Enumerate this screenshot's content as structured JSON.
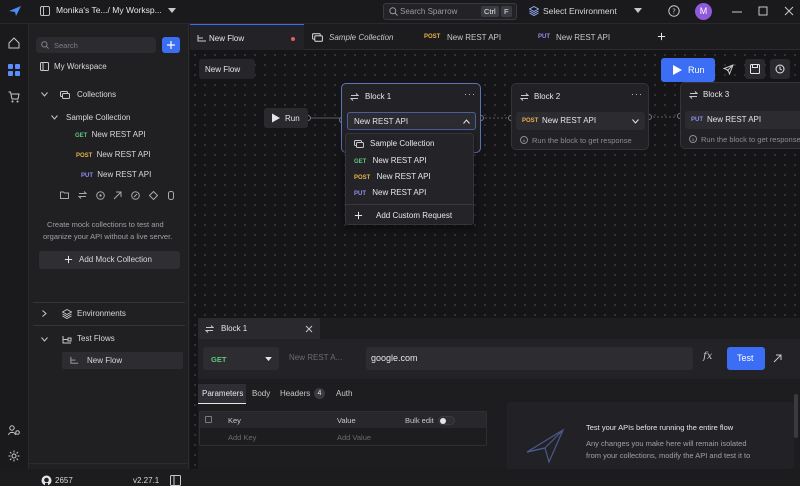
{
  "titlebar": {
    "workspace": "Monika's Te.../ My Worksp...",
    "search_placeholder": "Search Sparrow",
    "kbd1": "Ctrl",
    "kbd2": "F",
    "environment": "Select Environment",
    "avatar_letter": "M"
  },
  "sidebar": {
    "search_placeholder": "Search",
    "workspace": "My Workspace",
    "collections_label": "Collections",
    "collection_name": "Sample Collection",
    "requests": [
      {
        "method": "GET",
        "name": "New REST API"
      },
      {
        "method": "POST",
        "name": "New REST API"
      },
      {
        "method": "PUT",
        "name": "New REST API"
      }
    ],
    "mock_text_1": "Create mock collections to test and",
    "mock_text_2": "organize your API without a live server.",
    "mock_button": "Add Mock Collection",
    "environments_label": "Environments",
    "testflows_label": "Test Flows",
    "flow_item": "New Flow",
    "github_stars": "2657",
    "version": "v2.27.1"
  },
  "tabs": [
    {
      "label": "New Flow",
      "active": true
    },
    {
      "label": "Sample Collection",
      "active": false
    },
    {
      "method": "POST",
      "label": "New REST API",
      "active": false
    },
    {
      "method": "PUT",
      "label": "New REST API",
      "active": false
    }
  ],
  "canvas": {
    "flow_name": "New Flow",
    "run_button": "Run",
    "start_node": "Run",
    "block1": {
      "title": "Block 1",
      "selected": "New REST API"
    },
    "block2": {
      "title": "Block 2",
      "method": "POST",
      "request": "New REST API",
      "hint": "Run the block to get response"
    },
    "block3": {
      "title": "Block 3",
      "method": "PUT",
      "request": "New REST API",
      "hint": "Run the block to get response"
    },
    "dropdown": {
      "collection": "Sample Collection",
      "items": [
        {
          "method": "GET",
          "name": "New REST API"
        },
        {
          "method": "POST",
          "name": "New REST API"
        },
        {
          "method": "PUT",
          "name": "New REST API"
        }
      ],
      "add_custom": "Add Custom Request"
    }
  },
  "panel": {
    "tab_title": "Block 1",
    "method": "GET",
    "name_placeholder": "New REST A...",
    "url": "google.com",
    "test_button": "Test",
    "subtabs": [
      "Parameters",
      "Body",
      "Headers",
      "Auth"
    ],
    "headers_count": "4",
    "table_headers": {
      "key": "Key",
      "value": "Value",
      "bulk": "Bulk edit"
    },
    "add_key": "Add Key",
    "add_value": "Add Value",
    "info_title": "Test your APIs before running the entire flow",
    "info_line1": "Any changes you make here will remain isolated",
    "info_line2": "from your collections, modify the API and test it to"
  },
  "colors": {
    "accent": "#3b6ef5",
    "get": "#5fc87a",
    "post": "#e7b14c",
    "put": "#8e8ef0"
  }
}
